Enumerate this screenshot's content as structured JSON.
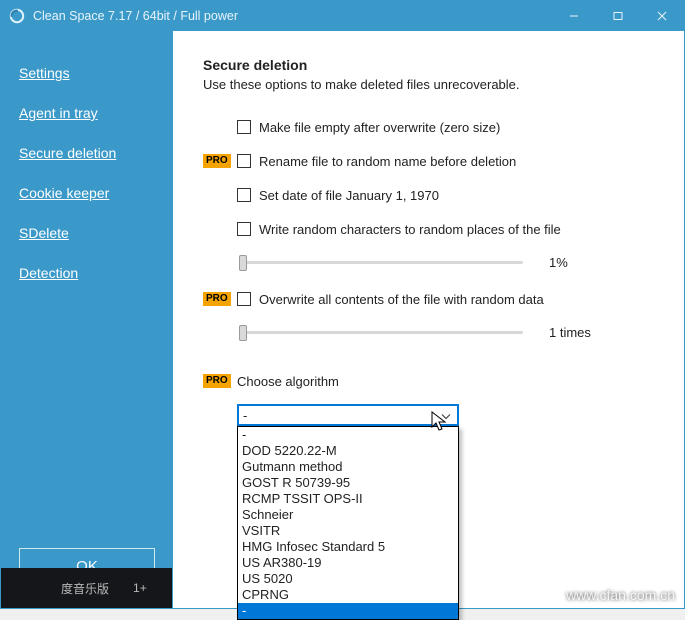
{
  "window": {
    "title": "Clean Space 7.17 / 64bit / Full power"
  },
  "sidebar": {
    "items": [
      {
        "label": "Settings"
      },
      {
        "label": "Agent in tray"
      },
      {
        "label": "Secure deletion"
      },
      {
        "label": "Cookie keeper"
      },
      {
        "label": "SDelete"
      },
      {
        "label": "Detection"
      }
    ],
    "ok_label": "OK"
  },
  "content": {
    "heading": "Secure deletion",
    "subheading": "Use these options to make deleted files unrecoverable.",
    "pro_badge": "PRO",
    "opt_empty": "Make file empty after overwrite (zero size)",
    "opt_rename": "Rename file to random name before deletion",
    "opt_date": "Set date of file January 1, 1970",
    "opt_random_places": "Write random characters to random places of the file",
    "slider1_value": "1%",
    "opt_overwrite_all": "Overwrite all contents of the file with random data",
    "slider2_value": "1 times",
    "algo_label": "Choose algorithm",
    "algo_selected": "-",
    "algo_options": [
      "-",
      "DOD 5220.22-M",
      "Gutmann method",
      "GOST R 50739-95",
      "RCMP TSSIT OPS-II",
      "Schneier",
      "VSITR",
      "HMG Infosec Standard 5",
      "US AR380-19",
      "US 5020",
      "CPRNG",
      "-"
    ]
  },
  "taskbar": {
    "text1": "度音乐版",
    "text2": "1+"
  },
  "watermark": "www.cfan.com.cn"
}
